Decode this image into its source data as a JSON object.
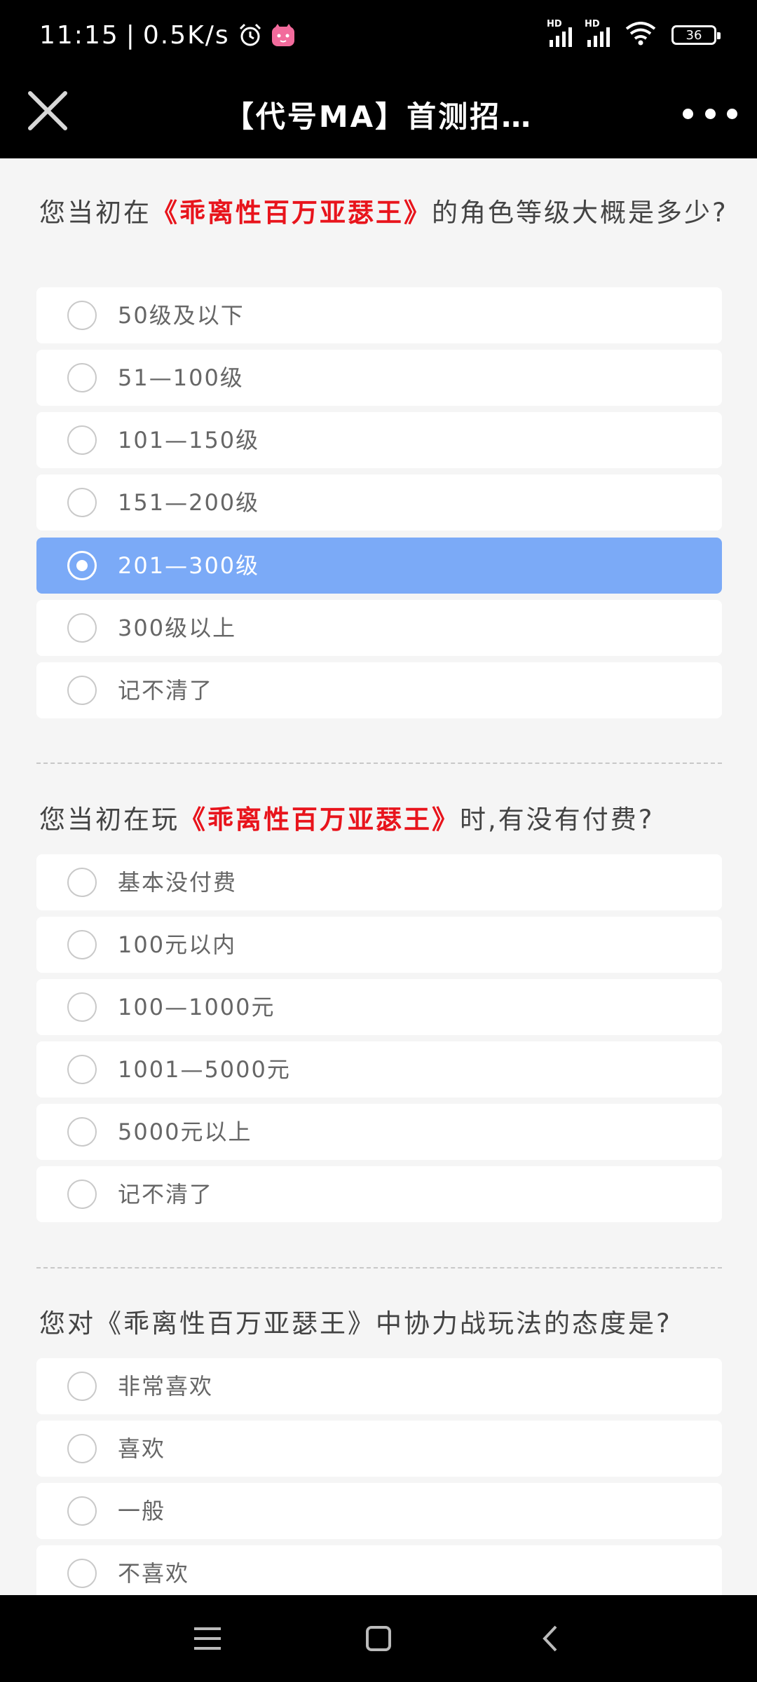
{
  "status": {
    "time": "11:15",
    "speed": "0.5K/s",
    "battery": "36"
  },
  "header": {
    "title": "【代号MA】首测招…"
  },
  "questions": [
    {
      "prefix": "您当初在",
      "game": "《乖离性百万亚瑟王》",
      "suffix": "的角色等级大概是多少?",
      "options": [
        "50级及以下",
        "51—100级",
        "101—150级",
        "151—200级",
        "201—300级",
        "300级以上",
        "记不清了"
      ],
      "selected": "201—300级"
    },
    {
      "prefix": "您当初在玩",
      "game": "《乖离性百万亚瑟王》",
      "suffix": "时,有没有付费?",
      "options": [
        "基本没付费",
        "100元以内",
        "100—1000元",
        "1001—5000元",
        "5000元以上",
        "记不清了"
      ],
      "selected": null
    },
    {
      "text": "您对《乖离性百万亚瑟王》中协力战玩法的态度是?",
      "options": [
        "非常喜欢",
        "喜欢",
        "一般",
        "不喜欢"
      ],
      "selected": null
    }
  ],
  "icons": {
    "close": "close-icon",
    "more": "more-icon",
    "alarm": "alarm-icon",
    "app": "app-icon",
    "wifi": "wifi-icon",
    "menu": "menu-icon",
    "home": "home-icon",
    "back": "back-icon"
  },
  "colors": {
    "selected": "#7baaf7",
    "highlight": "#e8141c",
    "background": "#f5f5f5"
  }
}
